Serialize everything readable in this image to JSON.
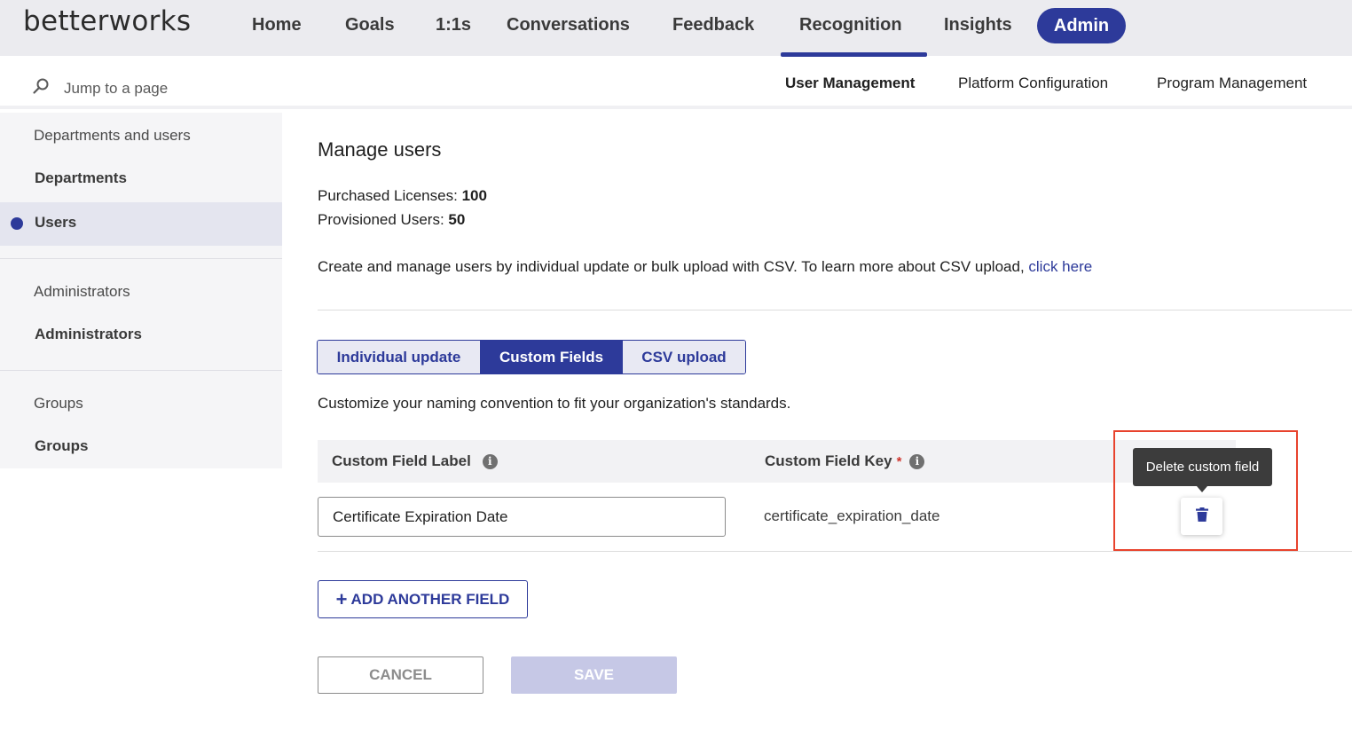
{
  "app": {
    "logo": "betterworks"
  },
  "top_nav": {
    "items": [
      {
        "label": "Home"
      },
      {
        "label": "Goals"
      },
      {
        "label": "1:1s"
      },
      {
        "label": "Conversations"
      },
      {
        "label": "Feedback"
      },
      {
        "label": "Recognition"
      },
      {
        "label": "Insights"
      },
      {
        "label": "Admin",
        "active": true
      }
    ]
  },
  "search": {
    "placeholder": "Jump to a page"
  },
  "sub_nav": {
    "tabs": [
      {
        "label": "User Management",
        "active": true
      },
      {
        "label": "Platform Configuration"
      },
      {
        "label": "Program Management"
      }
    ]
  },
  "sidebar": {
    "sections": [
      {
        "header": "Departments and users",
        "items": [
          "Departments",
          "Users"
        ]
      },
      {
        "header": "Administrators",
        "items": [
          "Administrators"
        ]
      },
      {
        "header": "Groups",
        "items": [
          "Groups"
        ]
      }
    ],
    "active_item": "Users"
  },
  "main": {
    "title": "Manage users",
    "purchased_label": "Purchased Licenses:",
    "purchased_value": "100",
    "provisioned_label": "Provisioned Users:",
    "provisioned_value": "50",
    "description": "Create and manage users by individual update or bulk upload with CSV. To learn more about CSV upload,",
    "description_link": "click here",
    "segments": [
      {
        "label": "Individual update"
      },
      {
        "label": "Custom Fields",
        "active": true
      },
      {
        "label": "CSV upload"
      }
    ],
    "customize_text": "Customize your naming convention to fit your organization's standards.",
    "table": {
      "col_label": "Custom Field Label",
      "col_key": "Custom Field Key",
      "required_mark": "*",
      "rows": [
        {
          "label_value": "Certificate Expiration Date",
          "key": "certificate_expiration_date"
        }
      ]
    },
    "tooltip": "Delete custom field",
    "add_field_label": "ADD ANOTHER FIELD",
    "cancel_label": "CANCEL",
    "save_label": "SAVE"
  },
  "colors": {
    "brand": "#2d3a9a",
    "highlight": "#e8432d",
    "save_disabled": "#c6c8e6"
  }
}
